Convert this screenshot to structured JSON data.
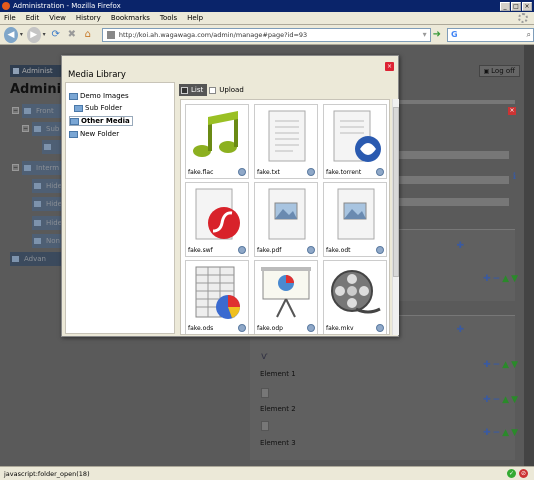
{
  "window": {
    "title": "Administration - Mozilla Firefox"
  },
  "menu": [
    "File",
    "Edit",
    "View",
    "History",
    "Bookmarks",
    "Tools",
    "Help"
  ],
  "toolbar": {
    "url": "http://koi.ah.wagawaga.com/admin/manage#page?id=93"
  },
  "page": {
    "top_strip": "Administ",
    "title": "Adminis",
    "log_off": "Log off",
    "tree": [
      {
        "label": "Front"
      },
      {
        "label": "Sub"
      },
      {
        "label": ""
      },
      {
        "label": "Interm"
      },
      {
        "label": "Hide"
      },
      {
        "label": "Hide"
      },
      {
        "label": "Hide"
      },
      {
        "label": "Non"
      },
      {
        "label": "Advan"
      }
    ],
    "elements": [
      {
        "label": "Element 1"
      },
      {
        "label": "Element 2"
      },
      {
        "label": "Element 3"
      }
    ]
  },
  "modal": {
    "title": "Media Library",
    "folders": [
      "Demo Images",
      "Sub Folder",
      "Other Media",
      "New Folder"
    ],
    "tabs": [
      "List",
      "Upload"
    ],
    "files": [
      "fake.flac",
      "fake.txt",
      "fake.torrent",
      "fake.swf",
      "fake.pdf",
      "fake.odt",
      "fake.ods",
      "fake.odp",
      "fake.mkv"
    ]
  },
  "status": {
    "text": "javascript:folder_open(18)"
  }
}
